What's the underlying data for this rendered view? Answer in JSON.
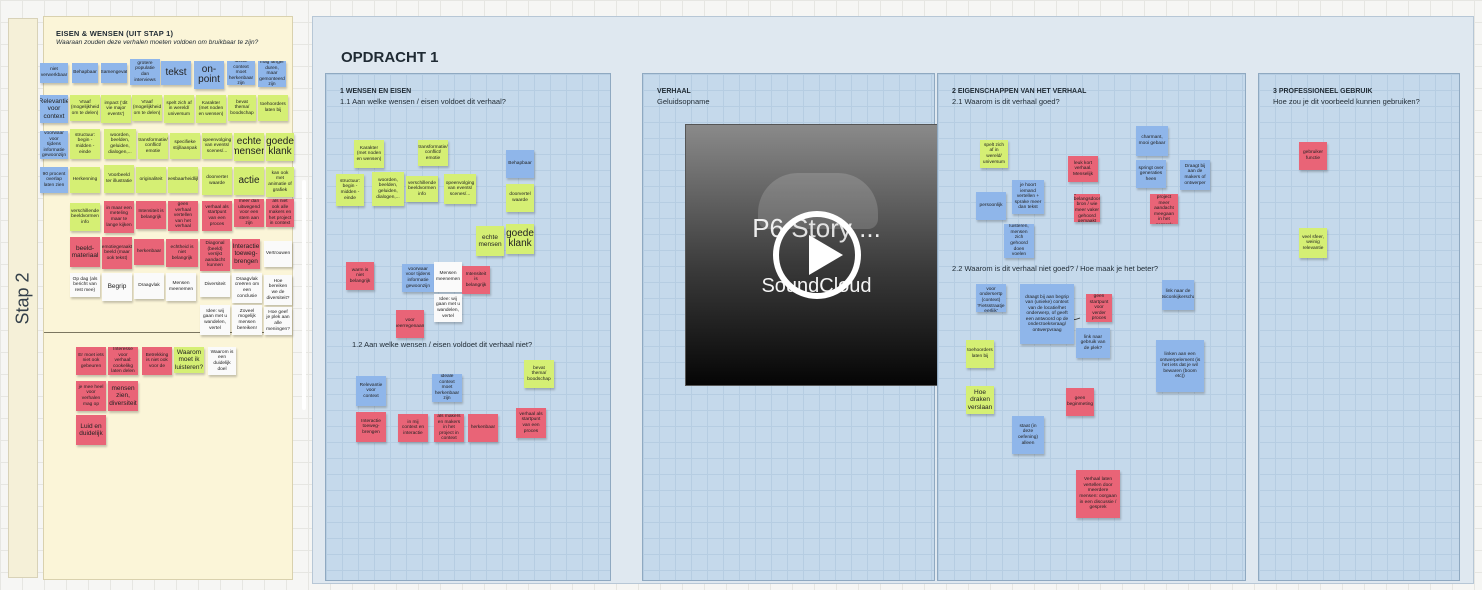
{
  "stap_label": "Stap 2",
  "left_panel": {
    "title": "EISEN & WENSEN (UIT STAP 1)",
    "subtitle": "Waaraan zouden deze verhalen moeten voldoen om bruikbaar te zijn?"
  },
  "board": {
    "title": "OPDRACHT 1",
    "columns": [
      {
        "heading": "1 WENSEN EN EISEN",
        "sub": "1.1 Aan welke wensen / eisen voldoet dit verhaal?",
        "sub2": "1.2 Aan welke wensen / eisen voldoet dit verhaal niet?"
      },
      {
        "heading": "VERHAAL",
        "sub": "Geluidsopname"
      },
      {
        "heading": "2 EIGENSCHAPPEN VAN HET VERHAAL",
        "sub": "2.1 Waarom is dit verhaal goed?",
        "sub2": "2.2 Waarom is dit verhaal niet goed? / Hoe maak je het beter?"
      },
      {
        "heading": "3 PROFESSIONEEL GEBRUIK",
        "sub": "Hoe zou je dit voorbeeld kunnen gebruiken?"
      }
    ]
  },
  "player": {
    "title": "P6 Story ...",
    "brand": "SoundCloud"
  },
  "left_notes": [
    {
      "t": "niet verwerkbaar",
      "c": "b"
    },
    {
      "t": "Behapbaar",
      "c": "b"
    },
    {
      "t": "Samengevat",
      "c": "b"
    },
    {
      "t": "grotere populatie dan interviews",
      "c": "b"
    },
    {
      "t": "tekst",
      "c": "b",
      "s": "big"
    },
    {
      "t": "on-point",
      "c": "b",
      "s": "big"
    },
    {
      "t": "Ideale context moet herkenbaar zijn",
      "c": "b"
    },
    {
      "t": "mag langer duren, maar gemonteerd zijn",
      "c": "b"
    },
    {
      "t": "Relevantie voor context",
      "c": "b",
      "s": "med"
    },
    {
      "t": "Vraaf (mogelijkheid om te delen)",
      "c": "g"
    },
    {
      "t": "impact ('dit vie major events')",
      "c": "g"
    },
    {
      "t": "Vraaf (mogelijkheid om te delen)",
      "c": "g"
    },
    {
      "t": "spelt zich af in wereld/ universum",
      "c": "g"
    },
    {
      "t": "Karakter (met noden en wensen)",
      "c": "g"
    },
    {
      "t": "bevat thema/ boodschap",
      "c": "g"
    },
    {
      "t": "toehoorders laten bij",
      "c": "g"
    },
    {
      "t": "voorwaar voor tijdens informatie gewoonzijn",
      "c": "b"
    },
    {
      "t": "structuur: begin - midden - einde",
      "c": "g"
    },
    {
      "t": "woorden, beelden, geluiden, dialogen,...",
      "c": "g"
    },
    {
      "t": "transformatie/ conflict/ emotie",
      "c": "g"
    },
    {
      "t": "specifieke stijl/aanpak",
      "c": "g"
    },
    {
      "t": "opeenvolging van events/ scenes/...",
      "c": "g"
    },
    {
      "t": "echte mensen",
      "c": "g",
      "s": "big"
    },
    {
      "t": "goede klank",
      "c": "g",
      "s": "big"
    },
    {
      "t": "90 procent overlap laten zien",
      "c": "b"
    },
    {
      "t": "Herkenning",
      "c": "g"
    },
    {
      "t": "Voorbeeld ter illustratie",
      "c": "g"
    },
    {
      "t": "originaliteit",
      "c": "g"
    },
    {
      "t": "leesbaarheidlijk",
      "c": "g"
    },
    {
      "t": "doorverteI waarde",
      "c": "g"
    },
    {
      "t": "actie",
      "c": "g",
      "s": "big"
    },
    {
      "t": "kan ook met animatie of grafiek",
      "c": "g"
    },
    {
      "t": "verschillende beeldvormen info",
      "c": "g"
    },
    {
      "t": "in maar een meteling maar te lange kijken",
      "c": "r"
    },
    {
      "t": "Intensiteit is belangrijk",
      "c": "r"
    },
    {
      "t": "geen verhaal vertellen van het verhaal",
      "c": "r"
    },
    {
      "t": "verhaal als startpunt van een proces",
      "c": "r"
    },
    {
      "t": "meer dan uitwegend voor een stem aan zijn",
      "c": "r"
    },
    {
      "t": "als niet ook alle makers en het project in context",
      "c": "r"
    },
    {
      "t": "beeld-materiaal",
      "c": "r",
      "s": "med"
    },
    {
      "t": "emotiegeraakt beeld (maar ook tekst)",
      "c": "r"
    },
    {
      "t": "herkenbaar",
      "c": "r"
    },
    {
      "t": "echtheid is niet belangrijk",
      "c": "r"
    },
    {
      "t": "Diagonal (beeld) verrijkt aandacht kunnen",
      "c": "r"
    },
    {
      "t": "Interactie toeweg-brengen",
      "c": "r",
      "s": "med"
    },
    {
      "t": "Vertrouwen",
      "c": "w"
    },
    {
      "t": "Op dag (als bericht van rest mee)",
      "c": "w"
    },
    {
      "t": "Begrip",
      "c": "w",
      "s": "med"
    },
    {
      "t": "Draagvlak",
      "c": "w"
    },
    {
      "t": "Mensen meenemen",
      "c": "w"
    },
    {
      "t": "Diversiteit",
      "c": "w"
    },
    {
      "t": "Draagvlak creëren om een conclusie",
      "c": "w"
    },
    {
      "t": "Hoe bereiken we de diversiteit?",
      "c": "w"
    },
    {
      "t": "Idee: wij gaan met u wandelen, vertel",
      "c": "w"
    },
    {
      "t": "Zoveel mogelijk mensen bereiken!",
      "c": "w"
    },
    {
      "t": "Hoe geef je plek aan alle meningen?",
      "c": "w"
    },
    {
      "t": "Er moet iets niet ook gebeuren",
      "c": "r"
    },
    {
      "t": "Interesse voor verhaal: cookelikg laten delen",
      "c": "r"
    },
    {
      "t": "Betrekking is niet ook voor de",
      "c": "r"
    },
    {
      "t": "Waarom moet ik luisteren?",
      "c": "g",
      "s": "med"
    },
    {
      "t": "Waarom is een duidelijk doel",
      "c": "w"
    },
    {
      "t": "je mee heel voor verhalen mag op",
      "c": "r"
    },
    {
      "t": "mensen zien, diversiteit",
      "c": "r",
      "s": "med"
    },
    {
      "t": "Luid en duidelijk",
      "c": "r",
      "s": "med"
    }
  ],
  "col1_notes": [
    {
      "t": "Karakter (met noden en wensen)",
      "c": "g"
    },
    {
      "t": "transformatie/ conflict/ emotie",
      "c": "g"
    },
    {
      "t": "Behapbaar",
      "c": "b"
    },
    {
      "t": "structuur: begin - midden - einde",
      "c": "g"
    },
    {
      "t": "woorden, beelden, geluiden, dialogen,...",
      "c": "g"
    },
    {
      "t": "verschillende beeldvormen info",
      "c": "g"
    },
    {
      "t": "opeenvolging van events/ scenes/...",
      "c": "g"
    },
    {
      "t": "doorvertel waarde",
      "c": "g"
    },
    {
      "t": "echte mensen",
      "c": "g",
      "s": "med"
    },
    {
      "t": "goede klank",
      "c": "g",
      "s": "big"
    },
    {
      "t": "warm is niet belangrijk",
      "c": "r"
    },
    {
      "t": "voorwaar voor tijdens informatie gewoonzijn",
      "c": "b"
    },
    {
      "t": "Mensen meenemen",
      "c": "w"
    },
    {
      "t": "Intensiteit is belangrijk",
      "c": "r"
    },
    {
      "t": "Idee: wij gaan met u wandelen, vertel",
      "c": "w"
    },
    {
      "t": "voor heerregenaam",
      "c": "r"
    },
    {
      "t": "bevat thema/ boodschap",
      "c": "g"
    },
    {
      "t": "Relevantie voor context",
      "c": "b"
    },
    {
      "t": "ideale context moet herkenbaar zijn",
      "c": "b"
    },
    {
      "t": "Interactie toeweg-brengen",
      "c": "r"
    },
    {
      "t": "in mij context en interactie",
      "c": "r"
    },
    {
      "t": "als makers en makers in het project in context",
      "c": "r"
    },
    {
      "t": "herkenbaar",
      "c": "r"
    },
    {
      "t": "verhaal als startpunt van een proces",
      "c": "r"
    }
  ],
  "col3_notes": [
    {
      "t": "spelt zich af in wereld/ universum",
      "c": "g"
    },
    {
      "t": "charmant, mooi gebaar",
      "c": "b"
    },
    {
      "t": "leuk kort verhaal. Menselijk",
      "c": "r"
    },
    {
      "t": "springt over generaties heen",
      "c": "b"
    },
    {
      "t": "Draagt bij aan de makers of ontwerper",
      "c": "b"
    },
    {
      "t": "persoonlijk",
      "c": "b"
    },
    {
      "t": "je hoort iemand vertellen + sprake meer dan tekst",
      "c": "b"
    },
    {
      "t": "gebruikt een belangsdoor bron / wie meer vaker gehoord gemaakt",
      "c": "r"
    },
    {
      "t": "doe het project meer aandacht meegaan in het gesprek",
      "c": "r"
    },
    {
      "t": "luisteren, mensen zich gehoord doen voelen",
      "c": "b"
    },
    {
      "t": "Relevantie voor ondersertp (context) 'Fietsstraatje eerlijk'",
      "c": "b"
    },
    {
      "t": "draagt bij aan begrip van (unieke) context van de locatie/het onderwerp, of geeft een antwoord op de onderzoeksvraag/ ontwerpvraag",
      "c": "b"
    },
    {
      "t": "geen startpunt voor verder proces",
      "c": "r"
    },
    {
      "t": "link naar de uitsiconkijkerschap",
      "c": "b"
    },
    {
      "t": "toehoorders laten bij",
      "c": "g"
    },
    {
      "t": "link naar gebruik van de plek?",
      "c": "b"
    },
    {
      "t": "linken aan een ontwerpelement (is het iets dat je wil bewaren (boom etc))",
      "c": "b"
    },
    {
      "t": "Hoe draken verslaan",
      "c": "g",
      "s": "med"
    },
    {
      "t": "geen beginmeting",
      "c": "r"
    },
    {
      "t": "staat (in deze oefening) alleen",
      "c": "b"
    },
    {
      "t": "Verhaal laten vertellen door meerdere mensen: oorgaan in een discussie / gesprek",
      "c": "r"
    }
  ],
  "col4_notes": [
    {
      "t": "gebruiker functie",
      "c": "r"
    },
    {
      "t": "veel sfeer, weinig relevantie",
      "c": "g"
    }
  ]
}
